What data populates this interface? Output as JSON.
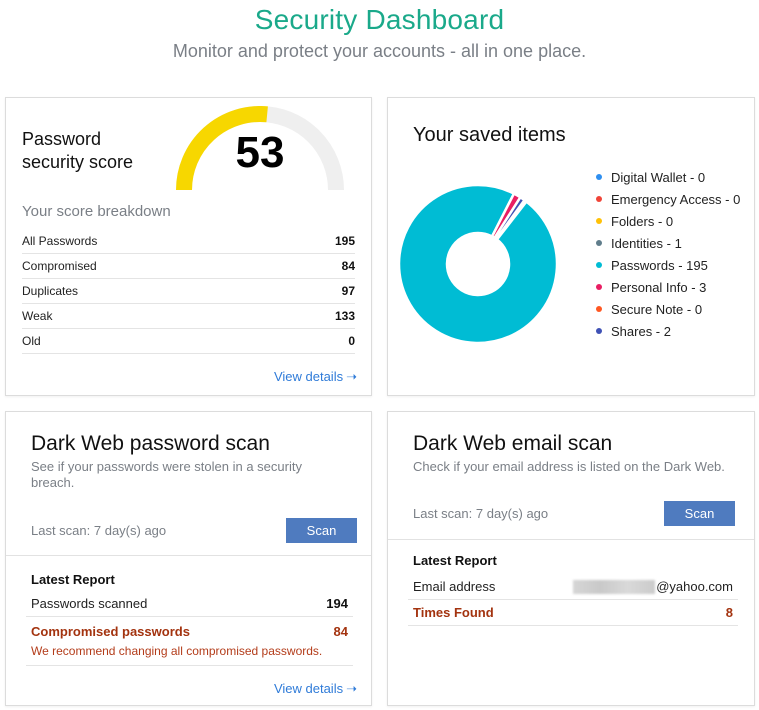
{
  "header": {
    "title": "Security Dashboard",
    "subtitle": "Monitor and protect your accounts - all in one place."
  },
  "score_card": {
    "title": "Password security score",
    "score": "53",
    "score_value": 53,
    "score_max": 100,
    "gauge_color": "#f7d700",
    "gauge_track_color": "#efefef",
    "breakdown_title": "Your score breakdown",
    "breakdown": [
      {
        "label": "All Passwords",
        "value": "195"
      },
      {
        "label": "Compromised",
        "value": "84"
      },
      {
        "label": "Duplicates",
        "value": "97"
      },
      {
        "label": "Weak",
        "value": "133"
      },
      {
        "label": "Old",
        "value": "0"
      }
    ],
    "view_details": "View details"
  },
  "saved_items": {
    "title": "Your saved items",
    "items": [
      {
        "label": "Digital Wallet - 0",
        "name": "Digital Wallet",
        "value": 0,
        "color": "#2e8ff0"
      },
      {
        "label": "Emergency Access - 0",
        "name": "Emergency Access",
        "value": 0,
        "color": "#f04438"
      },
      {
        "label": "Folders - 0",
        "name": "Folders",
        "value": 0,
        "color": "#ffc107"
      },
      {
        "label": "Identities - 1",
        "name": "Identities",
        "value": 1,
        "color": "#607d8b"
      },
      {
        "label": "Passwords - 195",
        "name": "Passwords",
        "value": 195,
        "color": "#00bcd4"
      },
      {
        "label": "Personal Info - 3",
        "name": "Personal Info",
        "value": 3,
        "color": "#e91e63"
      },
      {
        "label": "Secure Note - 0",
        "name": "Secure Note",
        "value": 0,
        "color": "#ff5722"
      },
      {
        "label": "Shares - 2",
        "name": "Shares",
        "value": 2,
        "color": "#3f51b5"
      }
    ]
  },
  "password_scan": {
    "title": "Dark Web password scan",
    "description": "See if your passwords were stolen in a security breach.",
    "last_scan": "Last scan: 7 day(s) ago",
    "scan_button": "Scan",
    "report_title": "Latest Report",
    "rows": [
      {
        "label": "Passwords scanned",
        "value": "194"
      },
      {
        "label": "Compromised passwords",
        "value": "84",
        "note": "We recommend changing all compromised passwords."
      }
    ],
    "view_details": "View details"
  },
  "email_scan": {
    "title": "Dark Web email scan",
    "description": "Check if your email address is listed on the Dark Web.",
    "last_scan": "Last scan: 7 day(s) ago",
    "scan_button": "Scan",
    "report_title": "Latest Report",
    "email_label": "Email address",
    "email_domain": "@yahoo.com",
    "times_found_label": "Times Found",
    "times_found": "8"
  },
  "icons": {
    "arrow": "➝"
  }
}
